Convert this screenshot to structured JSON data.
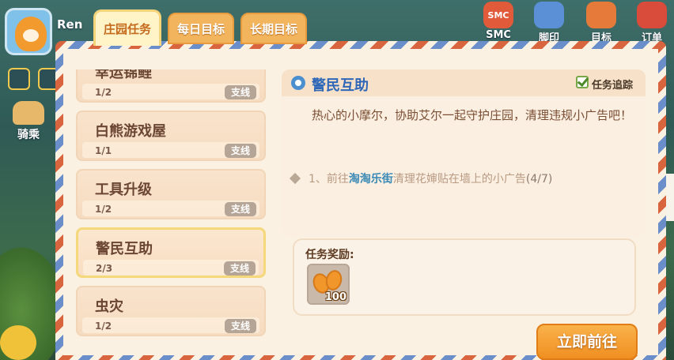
{
  "hud": {
    "player_name": "Ren",
    "mount_label": "骑乘",
    "top_icons": [
      {
        "label": "SMC",
        "icon": "smc-icon",
        "text": "SMC",
        "color": "#e15a3a"
      },
      {
        "label": "脚印",
        "icon": "footprint-icon",
        "text": "",
        "color": "#5b8fd6"
      },
      {
        "label": "目标",
        "icon": "target-scroll-icon",
        "text": "",
        "color": "#e57a3a"
      },
      {
        "label": "订单",
        "icon": "order-icon",
        "text": "",
        "color": "#d94b3a"
      }
    ]
  },
  "tabs": [
    {
      "label": "庄园任务",
      "active": true
    },
    {
      "label": "每日目标",
      "active": false
    },
    {
      "label": "长期目标",
      "active": false
    }
  ],
  "tasks": [
    {
      "title": "幸运锦鲤",
      "progress": "1/2",
      "tag": "支线",
      "selected": false
    },
    {
      "title": "白熊游戏屋",
      "progress": "1/1",
      "tag": "支线",
      "selected": false
    },
    {
      "title": "工具升级",
      "progress": "1/2",
      "tag": "支线",
      "selected": false
    },
    {
      "title": "警民互助",
      "progress": "2/3",
      "tag": "支线",
      "selected": true
    },
    {
      "title": "虫灾",
      "progress": "1/2",
      "tag": "支线",
      "selected": false
    }
  ],
  "detail": {
    "title": "警民互助",
    "track_label": "任务追踪",
    "description": "热心的小摩尔，协助艾尔一起守护庄园，清理违规小广告吧！",
    "step_prefix": "1、前往",
    "step_location": "淘淘乐街",
    "step_action": "清理花婶贴在墙上的小广告",
    "step_count": "(4/7)"
  },
  "reward": {
    "label": "任务奖励:",
    "item_icon": "golden-bean-icon",
    "quantity": "100"
  },
  "go_button": "立即前往",
  "colors": {
    "panel_bg": "#fbf1e2",
    "title_blue": "#2f67b8",
    "button_orange": "#f08f22",
    "tag_gray": "#b5a596"
  }
}
